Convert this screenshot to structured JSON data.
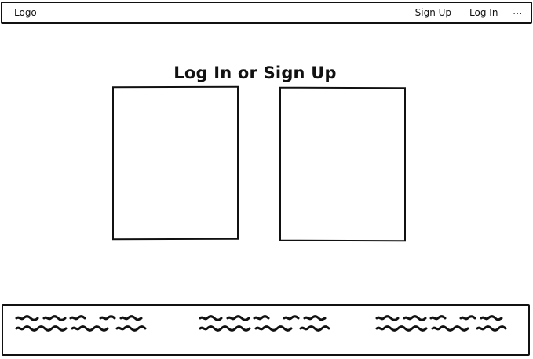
{
  "header": {
    "logo": "Logo",
    "nav": {
      "sign_up": "Sign Up",
      "log_in": "Log In",
      "more": "..."
    }
  },
  "main": {
    "title": "Log In or Sign Up"
  },
  "footer": {
    "columns": [
      {
        "icon": "scribble-text-icon"
      },
      {
        "icon": "scribble-text-icon"
      },
      {
        "icon": "scribble-text-icon"
      }
    ]
  }
}
